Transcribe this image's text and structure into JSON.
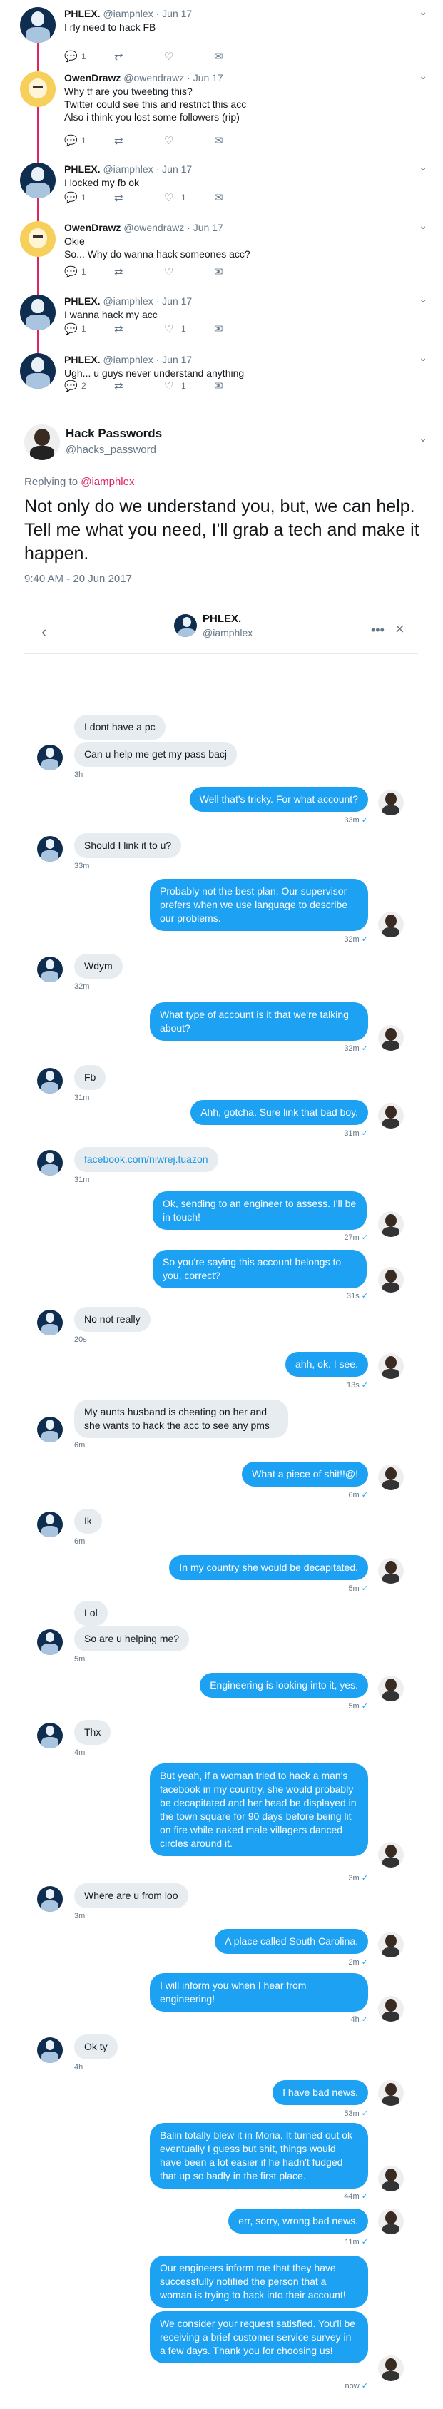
{
  "thread": [
    {
      "name": "PHLEX.",
      "handle": "@iamphlex",
      "date": "· Jun 17",
      "text": [
        "I rly need to hack FB"
      ],
      "replies": "1",
      "retweets": "",
      "likes": "",
      "av": "phlex"
    },
    {
      "name": "OwenDrawz",
      "handle": "@owendrawz",
      "date": "· Jun 17",
      "text": [
        "Why tf are you tweeting this?",
        "Twitter could see this and restrict this acc",
        "Also i think you lost some followers (rip)"
      ],
      "replies": "1",
      "retweets": "",
      "likes": "",
      "av": "owen"
    },
    {
      "name": "PHLEX.",
      "handle": "@iamphlex",
      "date": "· Jun 17",
      "text": [
        "I locked my fb ok"
      ],
      "replies": "1",
      "retweets": "",
      "likes": "1",
      "av": "phlex"
    },
    {
      "name": "OwenDrawz",
      "handle": "@owendrawz",
      "date": "· Jun 17",
      "text": [
        "Okie",
        "So... Why do wanna hack someones acc?"
      ],
      "replies": "1",
      "retweets": "",
      "likes": "",
      "av": "owen"
    },
    {
      "name": "PHLEX.",
      "handle": "@iamphlex",
      "date": "· Jun 17",
      "text": [
        "I wanna hack my acc"
      ],
      "replies": "1",
      "retweets": "",
      "likes": "1",
      "av": "phlex"
    },
    {
      "name": "PHLEX.",
      "handle": "@iamphlex",
      "date": "· Jun 17",
      "text": [
        "Ugh... u guys never understand anything"
      ],
      "replies": "2",
      "retweets": "",
      "likes": "1",
      "av": "phlex"
    }
  ],
  "main_tweet": {
    "name": "Hack Passwords",
    "handle": "@hacks_password",
    "replying_label": "Replying to",
    "replying_to": "@iamphlex",
    "text": "Not only do we understand you, but, we can help. Tell me what you need, I'll grab a tech and make it happen.",
    "time": "9:40 AM - 20 Jun 2017"
  },
  "dm_header": {
    "title": "PHLEX.",
    "handle": "@iamphlex"
  },
  "dm": [
    {
      "dir": "in",
      "text": "I dont have a pc"
    },
    {
      "dir": "in",
      "text": "Can u help me get my pass bacj",
      "time": "3h"
    },
    {
      "dir": "out",
      "text": "Well that's tricky. For what account?",
      "time": "33m"
    },
    {
      "dir": "in",
      "text": "Should I link it to u?",
      "time": "33m"
    },
    {
      "dir": "out",
      "text": "Probably not the best plan. Our supervisor prefers when we use language to describe our problems.",
      "time": "32m"
    },
    {
      "dir": "in",
      "text": "Wdym",
      "time": "32m"
    },
    {
      "dir": "out",
      "text": "What type of account is it that we're talking about?",
      "time": "32m"
    },
    {
      "dir": "in",
      "text": "Fb",
      "time": "31m"
    },
    {
      "dir": "out",
      "text": "Ahh, gotcha. Sure link that bad boy.",
      "time": "31m"
    },
    {
      "dir": "in",
      "text": "facebook.com/niwrej.tuazon",
      "time": "31m"
    },
    {
      "dir": "out",
      "text": "Ok, sending to an engineer to assess. I'll be in touch!",
      "time": "27m"
    },
    {
      "dir": "out",
      "text": "So you're saying this account belongs to you, correct?",
      "time": "31s"
    },
    {
      "dir": "in",
      "text": "No not really",
      "time": "20s"
    },
    {
      "dir": "out",
      "text": "ahh, ok. I see.",
      "time": "13s"
    },
    {
      "dir": "in",
      "text": "My aunts husband is cheating on her and she wants to hack the acc to see any pms",
      "time": "6m"
    },
    {
      "dir": "out",
      "text": "What a piece of shit!!@!",
      "time": "6m"
    },
    {
      "dir": "in",
      "text": "Ik",
      "time": "6m"
    },
    {
      "dir": "out",
      "text": "In my country she would be decapitated.",
      "time": "5m"
    },
    {
      "dir": "in",
      "text": "Lol"
    },
    {
      "dir": "in",
      "text": "So are u helping me?",
      "time": "5m"
    },
    {
      "dir": "out",
      "text": "Engineering is looking into it, yes.",
      "time": "5m"
    },
    {
      "dir": "in",
      "text": "Thx",
      "time": "4m"
    },
    {
      "dir": "out",
      "text": "But yeah, if a woman tried to hack a man's facebook in my country, she would probably be decapitated and her head be displayed in the town square for 90 days before being lit on fire while naked male villagers danced circles around it.",
      "time": "3m"
    },
    {
      "dir": "in",
      "text": "Where are u from loo",
      "time": "3m"
    },
    {
      "dir": "out",
      "text": "A place called South Carolina.",
      "time": "2m"
    },
    {
      "dir": "out",
      "text": "I will inform you when I hear from engineering!",
      "time": "4h"
    },
    {
      "dir": "in",
      "text": "Ok ty",
      "time": "4h"
    },
    {
      "dir": "out",
      "text": "I have bad news.",
      "time": "53m"
    },
    {
      "dir": "out",
      "text": "Balin totally blew it in Moria. It turned out ok eventually I guess but shit, things would have been a lot easier if he hadn't fudged that up so badly in the first place.",
      "time": "44m"
    },
    {
      "dir": "out",
      "text": "err, sorry, wrong bad news.",
      "time": "11m"
    },
    {
      "dir": "out",
      "text": "Our engineers inform me that they have successfully notified the person that a woman is trying to hack into their account!"
    },
    {
      "dir": "out",
      "text": "We consider your request satisfied. You'll be receiving a brief customer service survey in a few days. Thank you for choosing us!",
      "time": "now"
    }
  ],
  "colors": {
    "accent": "#1da1f2",
    "thread": "#e0245e",
    "muted": "#657786"
  },
  "icons": {
    "reply": "reply-icon",
    "retweet": "retweet-icon",
    "like": "heart-icon",
    "dm": "envelope-icon",
    "chevron": "chevron-down-icon"
  }
}
